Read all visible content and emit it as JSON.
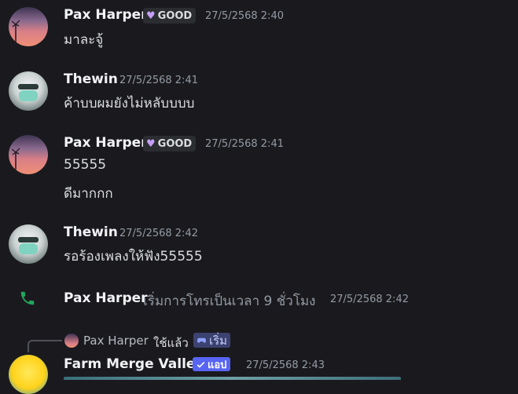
{
  "messages": [
    {
      "author": "Pax Harper",
      "tag": "GOOD",
      "timestamp": "27/5/2568 2:40",
      "lines": [
        "มาละจู้"
      ]
    },
    {
      "author": "Thewin",
      "timestamp": "27/5/2568 2:41",
      "lines": [
        "ค้าบบผมยังไม่หลับบบบ"
      ]
    },
    {
      "author": "Pax Harper",
      "tag": "GOOD",
      "timestamp": "27/5/2568 2:41",
      "lines": [
        "55555",
        "ดีมากกก"
      ]
    },
    {
      "author": "Thewin",
      "timestamp": "27/5/2568 2:42",
      "lines": [
        "รอร้องเพลงให้ฟัง55555"
      ]
    }
  ],
  "call": {
    "author": "Pax Harper",
    "text": "เริ่มการโทรเป็นเวลา 9 ชั่วโมง",
    "timestamp": "27/5/2568 2:42"
  },
  "app_message": {
    "reply_author": "Pax Harper",
    "reply_used": "ใช้แล้ว",
    "reply_command": "เริ่ม",
    "author": "Farm Merge Valley",
    "badge": "แอป",
    "timestamp": "27/5/2568 2:43"
  },
  "colors": {
    "background": "#1a1a1e",
    "app_badge": "#5865f2",
    "call_icon": "#23a55a",
    "tag_heart": "#c59ef5"
  }
}
